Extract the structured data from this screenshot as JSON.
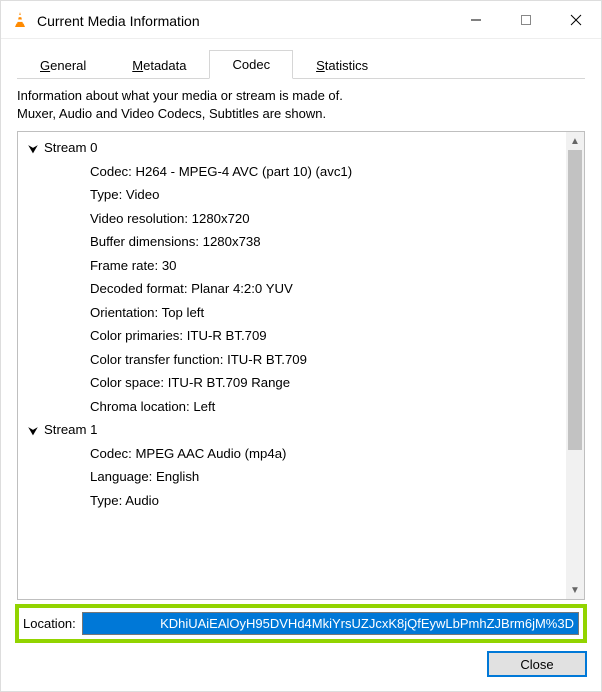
{
  "window": {
    "title": "Current Media Information"
  },
  "tabs": {
    "general": "General",
    "metadata": "Metadata",
    "codec": "Codec",
    "statistics": "Statistics",
    "active": "codec"
  },
  "info_text": "Information about what your media or stream is made of.\nMuxer, Audio and Video Codecs, Subtitles are shown.",
  "streams": [
    {
      "header": "Stream 0",
      "props": [
        "Codec: H264 - MPEG-4 AVC (part 10) (avc1)",
        "Type: Video",
        "Video resolution: 1280x720",
        "Buffer dimensions: 1280x738",
        "Frame rate: 30",
        "Decoded format: Planar 4:2:0 YUV",
        "Orientation: Top left",
        "Color primaries: ITU-R BT.709",
        "Color transfer function: ITU-R BT.709",
        "Color space: ITU-R BT.709 Range",
        "Chroma location: Left"
      ]
    },
    {
      "header": "Stream 1",
      "props": [
        "Codec: MPEG AAC Audio (mp4a)",
        "Language: English",
        "Type: Audio"
      ]
    }
  ],
  "location": {
    "label": "Location:",
    "value": "KDhiUAiEAlOyH95DVHd4MkiYrsUZJcxK8jQfEywLbPmhZJBrm6jM%3D"
  },
  "buttons": {
    "close": "Close"
  }
}
